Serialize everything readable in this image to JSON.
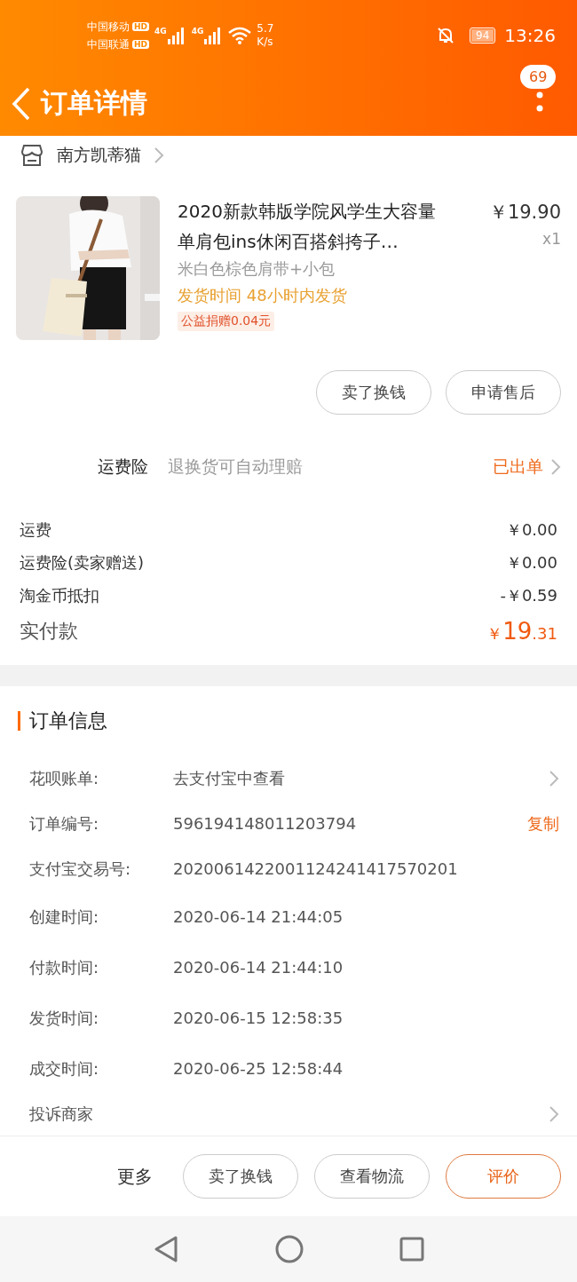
{
  "status_bar": {
    "carriers": [
      {
        "name": "中国移动",
        "badge": "HD"
      },
      {
        "name": "中国联通",
        "badge": "HD"
      }
    ],
    "networks": [
      "4G",
      "4G"
    ],
    "speed": "5.7",
    "speed_unit": "K/s",
    "battery": "94",
    "time": "13:26"
  },
  "nav": {
    "title": "订单详情",
    "badge": "69"
  },
  "store": {
    "name": "南方凯蒂猫"
  },
  "product": {
    "title": "2020新款韩版学院风学生大容量单肩包ins休闲百搭斜挎子…",
    "price": "￥19.90",
    "quantity": "x1",
    "variant": "米白色棕色肩带+小包",
    "shipping": "发货时间 48小时内发货",
    "donation": "公益捐赠0.04元"
  },
  "item_actions": [
    "卖了换钱",
    "申请售后"
  ],
  "insurance": {
    "label": "运费险",
    "description": "退换货可自动理赔",
    "status": "已出单"
  },
  "fees": [
    {
      "label": "运费",
      "value": "￥0.00"
    },
    {
      "label": "运费险(卖家赠送)",
      "value": "￥0.00"
    },
    {
      "label": "淘金币抵扣",
      "value": "-￥0.59"
    }
  ],
  "total": {
    "label": "实付款",
    "currency": "￥",
    "integer": "19",
    "decimal": ".31"
  },
  "order_info": {
    "title": "订单信息",
    "rows": [
      {
        "kind": "link",
        "label": "花呗账单:",
        "value": "去支付宝中查看"
      },
      {
        "kind": "copy",
        "label": "订单编号:",
        "value": "596194148011203794",
        "action": "复制"
      },
      {
        "kind": "plain",
        "label": "支付宝交易号:",
        "value": "2020061422001124241417570201"
      },
      {
        "kind": "plain",
        "label": "创建时间:",
        "value": "2020-06-14 21:44:05"
      },
      {
        "kind": "plain",
        "label": "付款时间:",
        "value": "2020-06-14 21:44:10"
      },
      {
        "kind": "plain",
        "label": "发货时间:",
        "value": "2020-06-15 12:58:35"
      },
      {
        "kind": "plain",
        "label": "成交时间:",
        "value": "2020-06-25 12:58:44"
      },
      {
        "kind": "link",
        "label": "投诉商家"
      }
    ]
  },
  "bottom_bar": {
    "more": "更多",
    "buttons": [
      {
        "label": "卖了换钱",
        "primary": false
      },
      {
        "label": "查看物流",
        "primary": false
      },
      {
        "label": "评价",
        "primary": true
      }
    ]
  }
}
